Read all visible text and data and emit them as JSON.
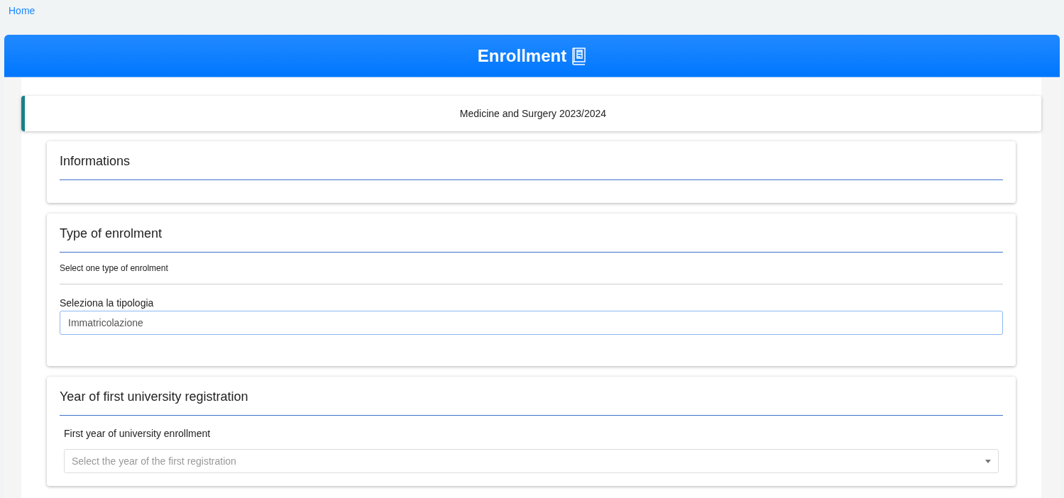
{
  "breadcrumb": {
    "link": "Home"
  },
  "header": {
    "title": "Enrollment"
  },
  "program": {
    "title": "Medicine and Surgery 2023/2024"
  },
  "sections": [
    {
      "kind": "info",
      "title": "Informations"
    },
    {
      "kind": "input",
      "title": "Type of enrolment",
      "note": "Select one type of enrolment",
      "label": "Seleziona la tipologia",
      "value": "Immatricolazione"
    },
    {
      "kind": "dropdown",
      "title": "Year of first university registration",
      "label": "First year of university enrollment",
      "placeholder": "Select the year of the first registration"
    }
  ]
}
